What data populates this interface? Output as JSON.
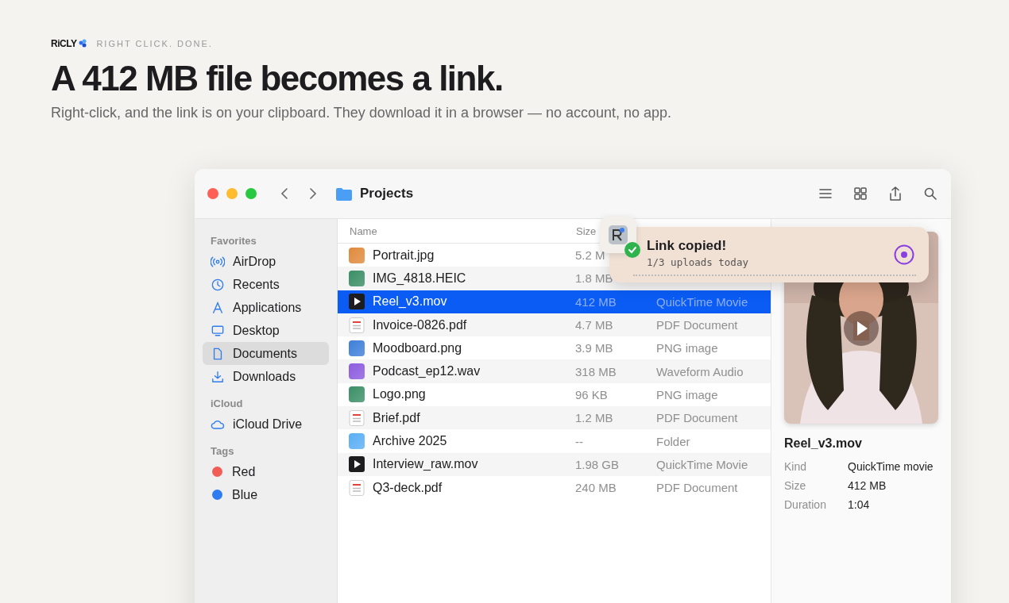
{
  "brand": {
    "logo": "RiCLY",
    "tagline": "RIGHT CLICK. DONE."
  },
  "headline": "A 412 MB file becomes a link.",
  "subhead": "Right-click, and the link is on your clipboard. They download it in a browser — no account, no app.",
  "window": {
    "title": "Projects"
  },
  "sidebar": {
    "sections": [
      {
        "heading": "Favorites",
        "items": [
          {
            "label": "AirDrop",
            "kind": "airdrop",
            "selected": false
          },
          {
            "label": "Recents",
            "kind": "clock",
            "selected": false
          },
          {
            "label": "Applications",
            "kind": "apps",
            "selected": false
          },
          {
            "label": "Desktop",
            "kind": "desktop",
            "selected": false
          },
          {
            "label": "Documents",
            "kind": "document",
            "selected": true
          },
          {
            "label": "Downloads",
            "kind": "download",
            "selected": false
          }
        ]
      },
      {
        "heading": "iCloud",
        "items": [
          {
            "label": "iCloud Drive",
            "kind": "cloud",
            "selected": false
          }
        ]
      },
      {
        "heading": "Tags",
        "items": [
          {
            "label": "Red",
            "kind": "tag",
            "color": "#f25c54",
            "selected": false
          },
          {
            "label": "Blue",
            "kind": "tag",
            "color": "#2f7bf0",
            "selected": false
          }
        ]
      }
    ]
  },
  "table": {
    "columns": [
      "Name",
      "Size"
    ],
    "rows": [
      {
        "name": "Portrait.jpg",
        "size": "5.2 M",
        "color": "#e08a3c",
        "selected": false
      },
      {
        "name": "IMG_4818.HEIC",
        "size": "1.8 MB",
        "color": "#3a8f66",
        "selected": false
      },
      {
        "name": "Reel_v3.mov",
        "size": "412 MB",
        "type": "QuickTime Movie",
        "kind": "video",
        "selected": true
      },
      {
        "name": "Invoice-0826.pdf",
        "size": "4.7 MB",
        "type": "PDF Document",
        "kind": "pdf",
        "selected": false
      },
      {
        "name": "Moodboard.png",
        "size": "3.9 MB",
        "type": "PNG image",
        "color": "#3d7fd9",
        "selected": false
      },
      {
        "name": "Podcast_ep12.wav",
        "size": "318 MB",
        "type": "Waveform Audio",
        "color": "#8d5ce0",
        "selected": false
      },
      {
        "name": "Logo.png",
        "size": "96 KB",
        "type": "PNG image",
        "color": "#3a8f66",
        "selected": false
      },
      {
        "name": "Brief.pdf",
        "size": "1.2 MB",
        "type": "PDF Document",
        "kind": "pdf",
        "selected": false
      },
      {
        "name": "Archive 2025",
        "size": "--",
        "type": "Folder",
        "color": "#5aaef5",
        "selected": false
      },
      {
        "name": "Interview_raw.mov",
        "size": "1.98 GB",
        "type": "QuickTime Movie",
        "kind": "video",
        "selected": false
      },
      {
        "name": "Q3-deck.pdf",
        "size": "240 MB",
        "type": "PDF Document",
        "kind": "pdf",
        "selected": false
      }
    ]
  },
  "toast": {
    "title": "Link copied!",
    "subtitle": "1/3 uploads today"
  },
  "preview": {
    "filename": "Reel_v3.mov",
    "properties": [
      {
        "label": "Kind",
        "value": "QuickTime movie"
      },
      {
        "label": "Size",
        "value": "412 MB"
      },
      {
        "label": "Duration",
        "value": "1:04"
      }
    ]
  }
}
